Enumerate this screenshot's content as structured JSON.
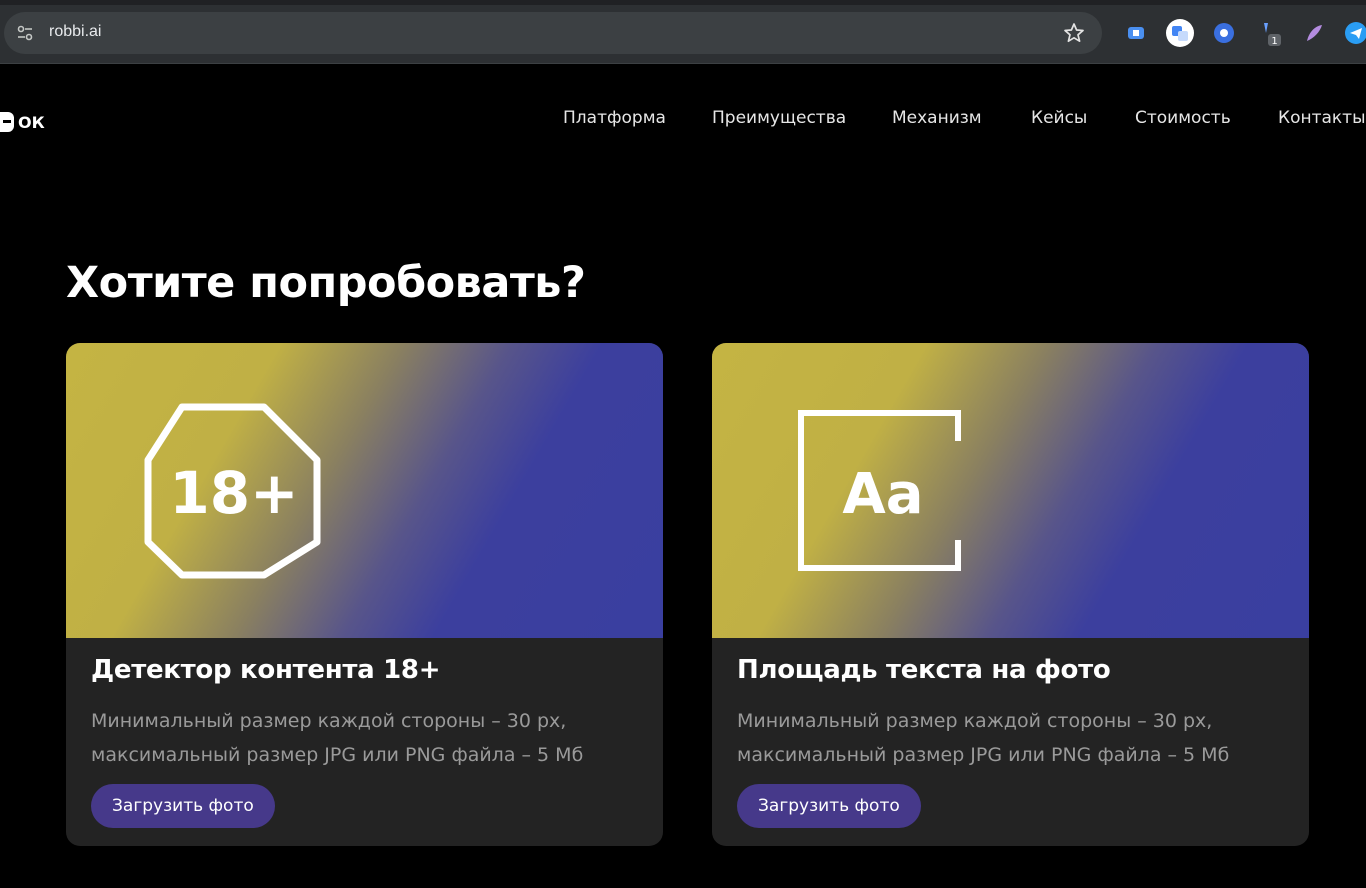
{
  "browser": {
    "url": "robbi.ai",
    "extensions": [
      "extension-icon-1",
      "translate-extension-icon",
      "extension-icon-3",
      "extension-badge-icon",
      "feather-extension-icon",
      "send-extension-icon"
    ],
    "extension_badge_count": "1"
  },
  "header": {
    "logo_text": "ОК",
    "nav": [
      {
        "label": "Платформа"
      },
      {
        "label": "Преимущества"
      },
      {
        "label": "Механизм"
      },
      {
        "label": "Кейсы"
      },
      {
        "label": "Стоимость"
      },
      {
        "label": "Контакты"
      }
    ]
  },
  "main": {
    "heading": "Хотите попробовать?",
    "cards": [
      {
        "icon": "age-restriction-18-icon",
        "icon_text": "18+",
        "title": "Детектор контента 18+",
        "description_line1": "Минимальный размер каждой стороны – 30 px,",
        "description_line2": "максимальный размер JPG или PNG файла – 5 Мб",
        "button_label": "Загрузить фото"
      },
      {
        "icon": "text-area-icon",
        "icon_text": "Aa",
        "title": "Площадь текста на фото",
        "description_line1": "Минимальный размер каждой стороны – 30 px,",
        "description_line2": "максимальный размер JPG или PNG файла – 5 Мб",
        "button_label": "Загрузить фото"
      }
    ]
  },
  "colors": {
    "background": "#000000",
    "card_background": "#232323",
    "button": "#46398a",
    "gradient_yellow": "#c4b443",
    "gradient_blue": "#3a3fa0"
  }
}
